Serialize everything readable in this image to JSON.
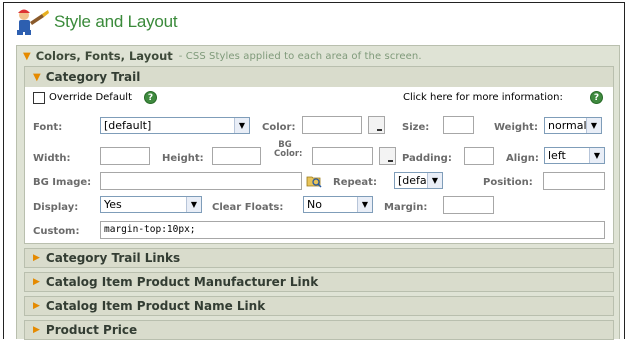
{
  "page": {
    "title": "Style and Layout"
  },
  "section": {
    "title": "Colors, Fonts, Layout",
    "subtitle": "- CSS Styles applied to each area of the screen."
  },
  "category_trail": {
    "title": "Category Trail",
    "override_label": "Override Default",
    "help_text": "Click here for more information:",
    "labels": {
      "font": "Font:",
      "color": "Color:",
      "size": "Size:",
      "weight": "Weight:",
      "width": "Width:",
      "height": "Height:",
      "bg_color": "BG Color:",
      "padding": "Padding:",
      "align": "Align:",
      "bg_image": "BG Image:",
      "repeat": "Repeat:",
      "position": "Position:",
      "display": "Display:",
      "clear_floats": "Clear Floats:",
      "margin": "Margin:",
      "custom": "Custom:"
    },
    "values": {
      "font": "[default]",
      "weight": "normal",
      "align": "left",
      "repeat": "[default]",
      "display": "Yes",
      "clear_floats": "No",
      "custom": "margin-top:10px;"
    }
  },
  "collapsed_sections": [
    "Category Trail Links",
    "Catalog Item Product Manufacturer Link",
    "Catalog Item Product Name Link",
    "Product Price"
  ],
  "colors": {
    "title_green": "#3a8a3a",
    "panel_bg": "#dfe3d5",
    "accent_orange": "#e58a00"
  }
}
